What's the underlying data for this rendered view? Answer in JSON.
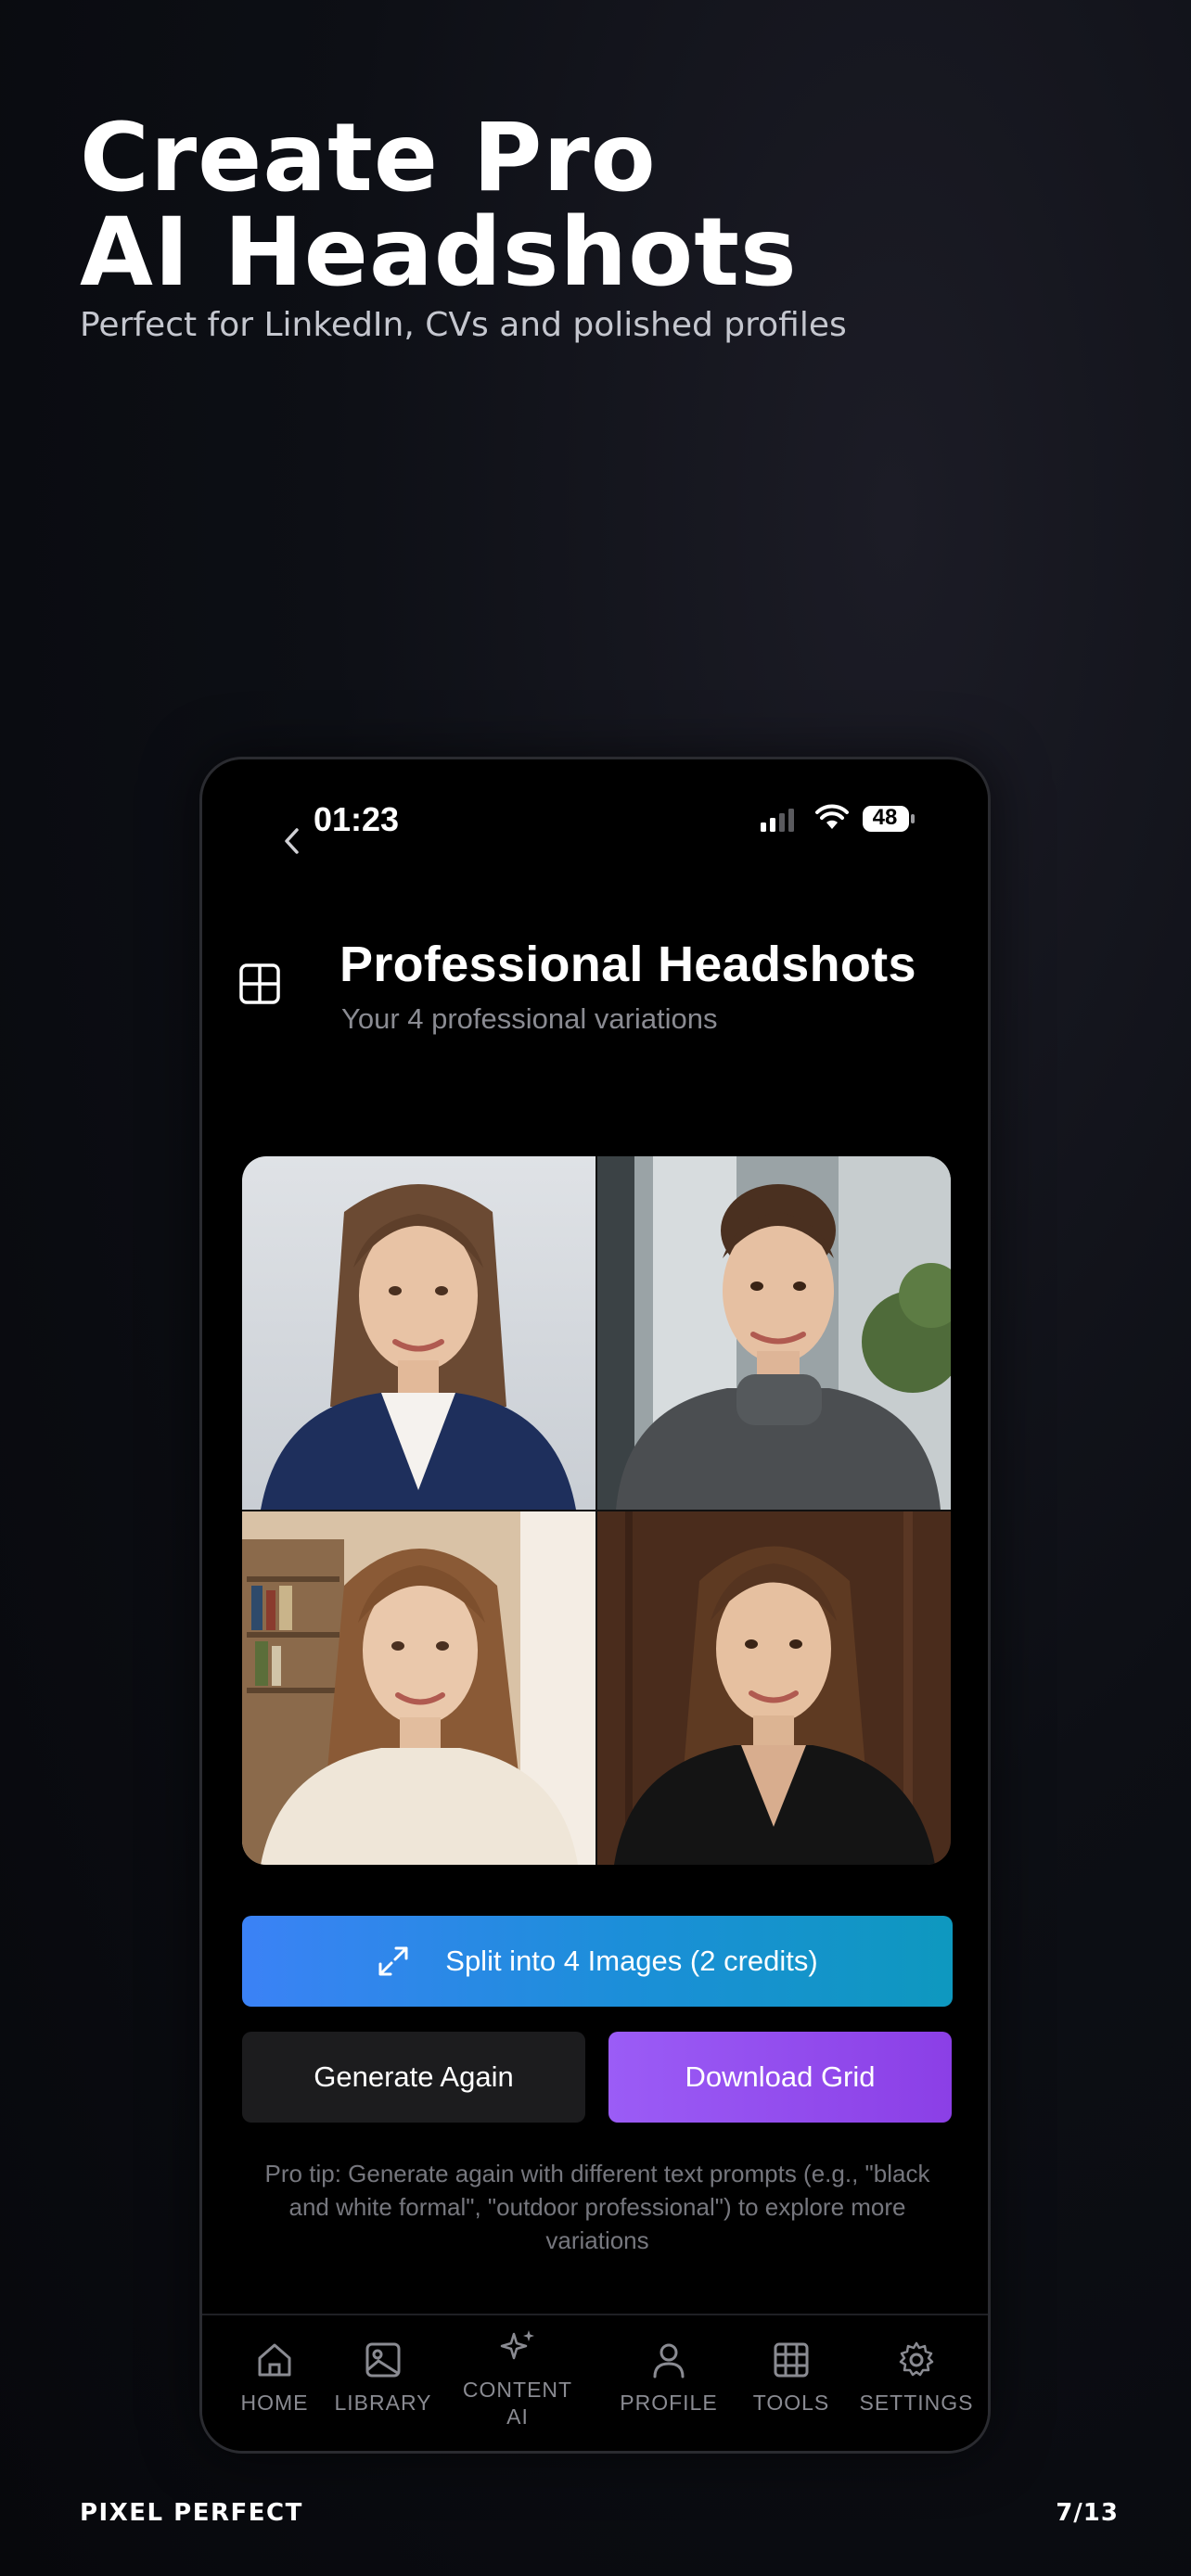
{
  "hero": {
    "title_line1": "Create Pro",
    "title_line2": "AI Headshots",
    "subtitle": "Perfect for LinkedIn, CVs and polished profiles"
  },
  "status_bar": {
    "time": "01:23",
    "battery": "48"
  },
  "screen": {
    "title": "Professional Headshots",
    "subtitle": "Your 4 professional variations"
  },
  "buttons": {
    "split": "Split into 4 Images (2 credits)",
    "generate_again": "Generate Again",
    "download_grid": "Download Grid"
  },
  "tip": "Pro tip: Generate again with different text prompts (e.g., \"black and white formal\", \"outdoor professional\") to explore more variations",
  "tabs": {
    "home": "HOME",
    "library": "LIBRARY",
    "content_ai_line1": "CONTENT",
    "content_ai_line2": "AI",
    "profile": "PROFILE",
    "tools": "TOOLS",
    "settings": "SETTINGS"
  },
  "footer": {
    "brand": "PIXEL PERFECT",
    "page": "7/13"
  },
  "colors": {
    "split_button": "#3b82f6",
    "download_button": "#9b5cf6",
    "secondary_button": "#1c1c1e"
  }
}
